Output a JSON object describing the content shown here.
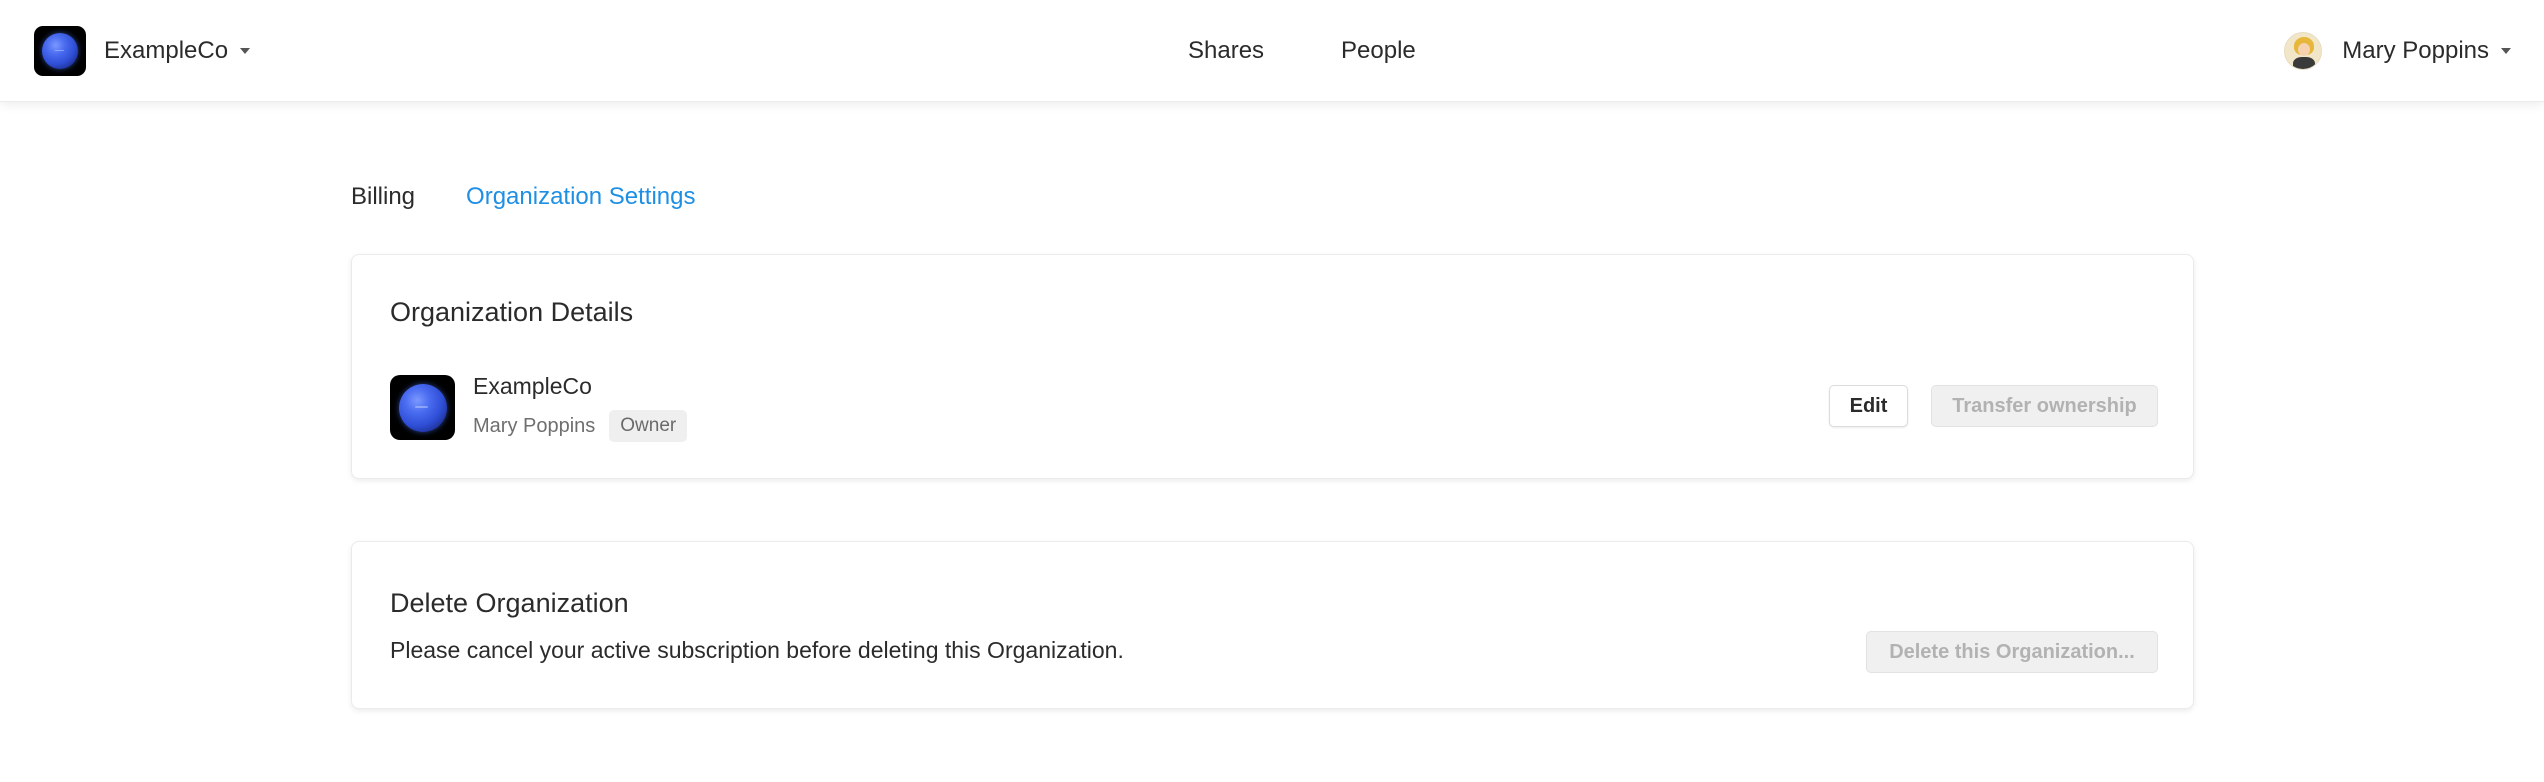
{
  "header": {
    "org_name": "ExampleCo",
    "nav": [
      {
        "label": "Shares"
      },
      {
        "label": "People"
      }
    ],
    "user_name": "Mary Poppins"
  },
  "tabs": [
    {
      "label": "Billing",
      "active": false
    },
    {
      "label": "Organization Settings",
      "active": true
    }
  ],
  "org_details": {
    "title": "Organization Details",
    "org_name": "ExampleCo",
    "owner_name": "Mary Poppins",
    "role_badge": "Owner",
    "edit_label": "Edit",
    "transfer_label": "Transfer ownership"
  },
  "delete_org": {
    "title": "Delete Organization",
    "message": "Please cancel your active subscription before deleting this Organization.",
    "button_label": "Delete this Organization..."
  },
  "icons": {
    "org_logo": "planet-logo-icon",
    "org_caret": "chevron-down-icon",
    "user_avatar": "avatar",
    "user_caret": "chevron-down-icon"
  },
  "colors": {
    "accent": "#1e8fe3",
    "text": "#2b2b2b",
    "muted": "#6f6f6f",
    "disabled_text": "#b2b2b2"
  }
}
